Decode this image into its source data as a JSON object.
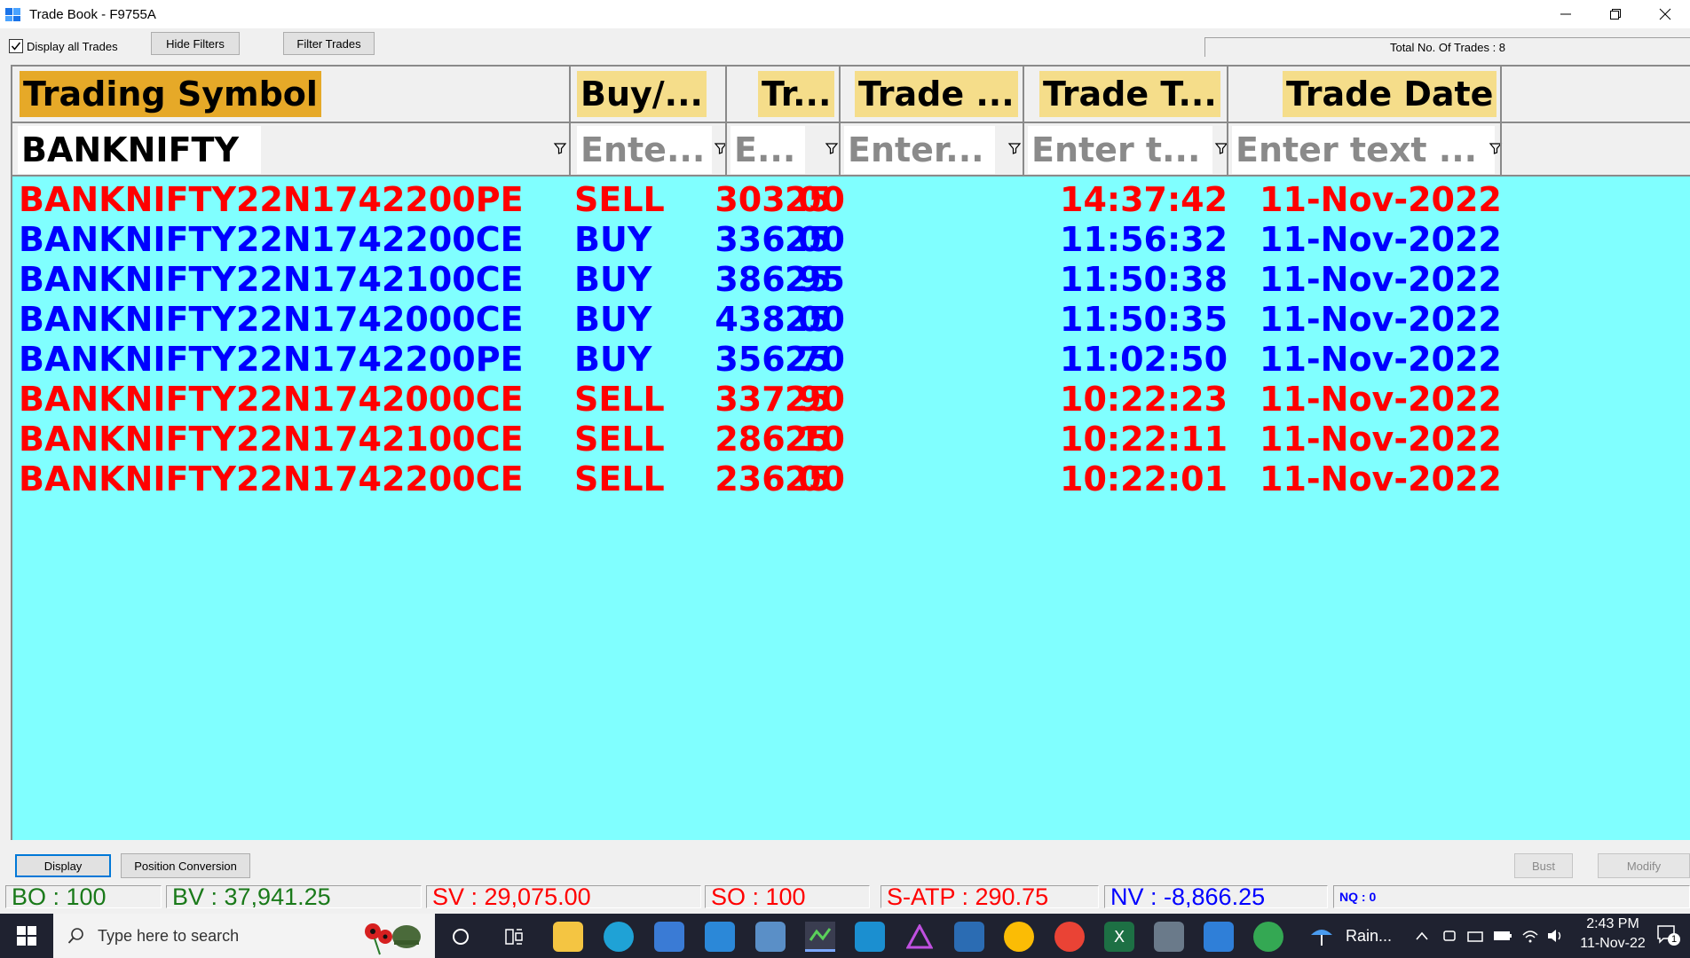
{
  "window": {
    "title": "Trade Book - F9755A"
  },
  "toolbar": {
    "display_all_label": "Display all Trades",
    "display_all_checked": true,
    "hide_filters_label": "Hide Filters",
    "filter_trades_label": "Filter Trades",
    "total_trades": "Total No. Of Trades : 8"
  },
  "grid": {
    "columns": [
      {
        "header": "Trading Symbol",
        "filter_value": "BANKNIFTY",
        "filter_placeholder": ""
      },
      {
        "header": "Buy/...",
        "filter_value": "",
        "filter_placeholder": "Ente..."
      },
      {
        "header": "Tr...",
        "filter_value": "",
        "filter_placeholder": "E..."
      },
      {
        "header": "Trade ...",
        "filter_value": "",
        "filter_placeholder": "Enter..."
      },
      {
        "header": "Trade T...",
        "filter_value": "",
        "filter_placeholder": "Enter t..."
      },
      {
        "header": "Trade Date",
        "filter_value": "",
        "filter_placeholder": "Enter text ..."
      }
    ],
    "rows": [
      {
        "symbol": "BANKNIFTY22N1742200PE",
        "side": "SELL",
        "qty": "25",
        "price": "303.00",
        "time": "14:37:42",
        "date": "11-Nov-2022"
      },
      {
        "symbol": "BANKNIFTY22N1742200CE",
        "side": "BUY",
        "qty": "25",
        "price": "336.00",
        "time": "11:56:32",
        "date": "11-Nov-2022"
      },
      {
        "symbol": "BANKNIFTY22N1742100CE",
        "side": "BUY",
        "qty": "25",
        "price": "386.95",
        "time": "11:50:38",
        "date": "11-Nov-2022"
      },
      {
        "symbol": "BANKNIFTY22N1742000CE",
        "side": "BUY",
        "qty": "25",
        "price": "438.00",
        "time": "11:50:35",
        "date": "11-Nov-2022"
      },
      {
        "symbol": "BANKNIFTY22N1742200PE",
        "side": "BUY",
        "qty": "25",
        "price": "356.70",
        "time": "11:02:50",
        "date": "11-Nov-2022"
      },
      {
        "symbol": "BANKNIFTY22N1742000CE",
        "side": "SELL",
        "qty": "25",
        "price": "337.90",
        "time": "10:22:23",
        "date": "11-Nov-2022"
      },
      {
        "symbol": "BANKNIFTY22N1742100CE",
        "side": "SELL",
        "qty": "25",
        "price": "286.10",
        "time": "10:22:11",
        "date": "11-Nov-2022"
      },
      {
        "symbol": "BANKNIFTY22N1742200CE",
        "side": "SELL",
        "qty": "25",
        "price": "236.00",
        "time": "10:22:01",
        "date": "11-Nov-2022"
      }
    ]
  },
  "bottom": {
    "display_label": "Display",
    "position_conversion_label": "Position Conversion",
    "bust_label": "Bust",
    "modify_label": "Modify"
  },
  "status": {
    "bo": "BO : 100",
    "bv": "BV : 37,941.25",
    "sv": "SV : 29,075.00",
    "so": "SO : 100",
    "satp": "S-ATP : 290.75",
    "nv": "NV : -8,866.25",
    "nq": "NQ : 0"
  },
  "taskbar": {
    "search_placeholder": "Type here to search",
    "weather": "Rain...",
    "time": "2:43 PM",
    "date": "11-Nov-22",
    "notification_count": "1"
  },
  "colors": {
    "buy": "#0000ff",
    "sell": "#ff0000",
    "grid_bg": "#80ffff",
    "header_hl": "#f5dd8a",
    "header_sorted": "#e6a928"
  }
}
